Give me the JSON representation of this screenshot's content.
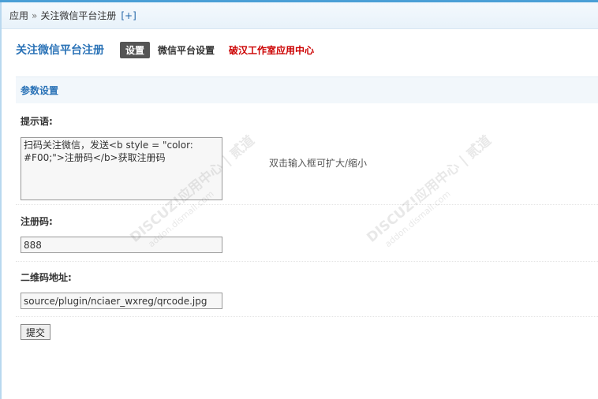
{
  "breadcrumb": {
    "root": "应用",
    "separator": "»",
    "current": "关注微信平台注册",
    "add_label": "[+]"
  },
  "header": {
    "title": "关注微信平台注册",
    "tabs": [
      {
        "label": "设置",
        "active": true
      },
      {
        "label": "微信平台设置",
        "active": false
      },
      {
        "label": "破汉工作室应用中心",
        "active": false,
        "color": "#cc0000"
      }
    ]
  },
  "section": {
    "title": "参数设置"
  },
  "fields": {
    "prompt": {
      "label": "提示语:",
      "value": "扫码关注微信，发送<b style = \"color: #F00;\">注册码</b>获取注册码",
      "hint": "双击输入框可扩大/缩小"
    },
    "code": {
      "label": "注册码:",
      "value": "888"
    },
    "qrcode": {
      "label": "二维码地址:",
      "value": "source/plugin/nciaer_wxreg/qrcode.jpg"
    }
  },
  "submit": {
    "label": "提交"
  },
  "watermark": {
    "text": "DISCUZ!应用中心 | 贰道",
    "subtext": "addon.dismall.com"
  },
  "colors": {
    "accent": "#2b73b7",
    "top_strip": "#4a9fd6",
    "red_link": "#cc0000"
  }
}
